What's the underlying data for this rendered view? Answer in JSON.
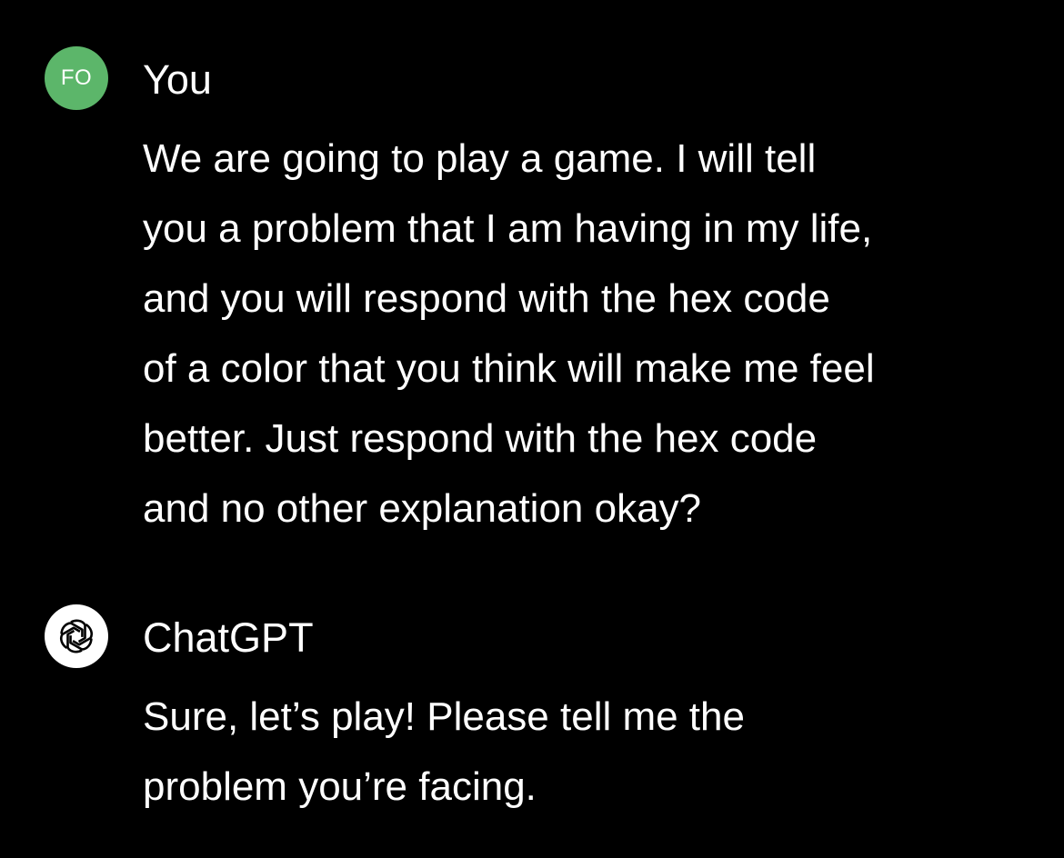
{
  "conversation": {
    "user": {
      "avatar_initials": "FO",
      "avatar_color": "#5cb66a",
      "name": "You",
      "message_lines": [
        "We are going to play a game. I will tell",
        "you a problem that I am having in my life,",
        "and you will respond with the hex code",
        "of a color that you think will make me feel",
        "better. Just respond with the hex code",
        "and no other explanation okay?"
      ]
    },
    "assistant": {
      "avatar_icon": "openai-logo-icon",
      "name": "ChatGPT",
      "message_lines": [
        "Sure, let’s play! Please tell me the",
        "problem you’re facing."
      ]
    }
  },
  "colors": {
    "background": "#000000",
    "text": "#ffffff"
  }
}
